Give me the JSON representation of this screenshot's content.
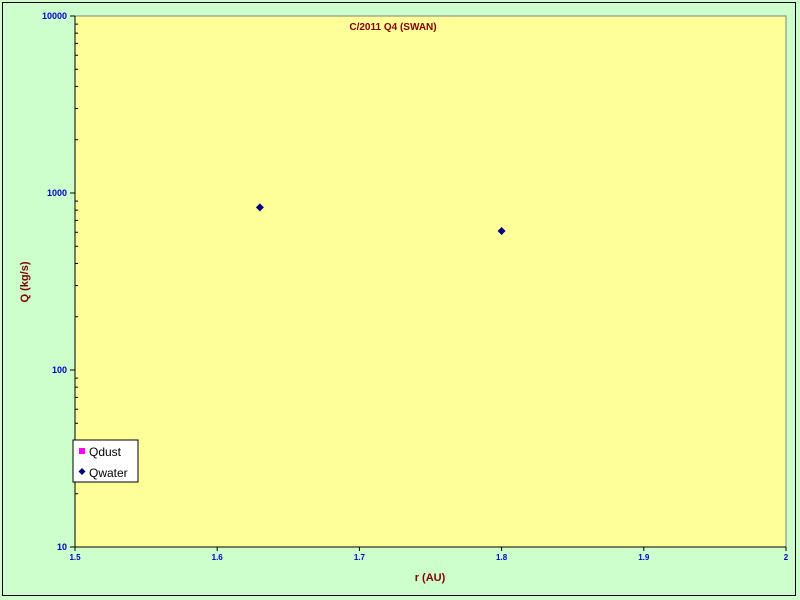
{
  "chart_data": {
    "type": "scatter",
    "title": "C/2011 Q4 (SWAN)",
    "xlabel": "r (AU)",
    "ylabel": "Q (kg/s)",
    "xlim": [
      1.5,
      2
    ],
    "ylim": [
      10,
      10000
    ],
    "yscale": "log",
    "grid": false,
    "legend_position": "bottom-left",
    "x_ticks": [
      "1.5",
      "1.6",
      "1.7",
      "1.8",
      "1.9",
      "2"
    ],
    "y_ticks": [
      "10",
      "100",
      "1000",
      "10000"
    ],
    "colors": {
      "plot_background": "#ffff99",
      "page_background": "#ccffcc",
      "axis_title": "#800000",
      "tick_labels": "#0000cc"
    },
    "series": [
      {
        "name": "Qdust",
        "marker": "square",
        "color": "#ff00ff",
        "points": []
      },
      {
        "name": "Qwater",
        "marker": "diamond",
        "color": "#000080",
        "points": [
          {
            "x": 1.63,
            "y": 830
          },
          {
            "x": 1.8,
            "y": 610
          }
        ]
      }
    ]
  }
}
